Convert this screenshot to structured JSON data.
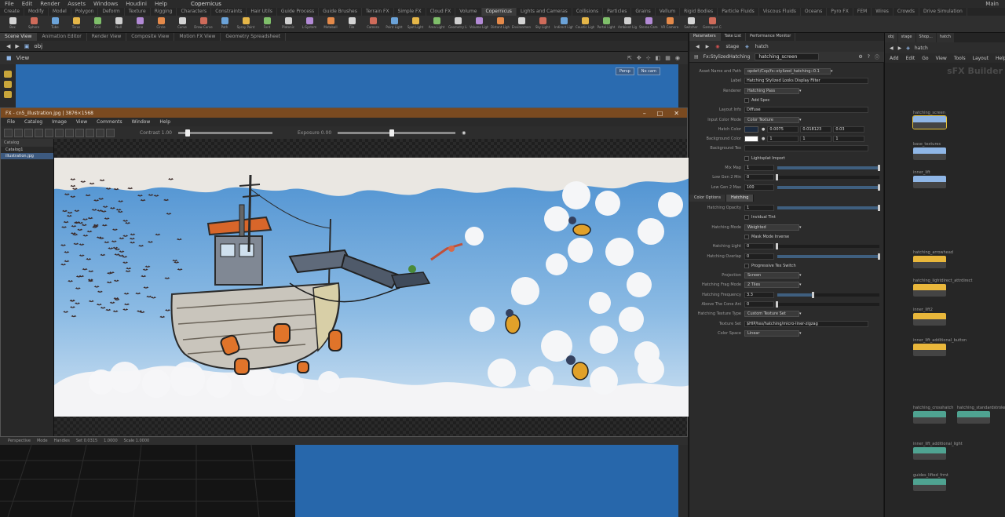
{
  "menubar": {
    "items": [
      "File",
      "Edit",
      "Render",
      "Assets",
      "Windows",
      "Houdini",
      "Help"
    ],
    "desktop": "Copernicus",
    "right_label": "Main"
  },
  "shelf_tabs": [
    "Create",
    "Modify",
    "Model",
    "Polygon",
    "Deform",
    "Texture",
    "Rigging",
    "Characters",
    "Constraints",
    "Hair Utils",
    "Guide Process",
    "Guide Brushes",
    "Terrain FX",
    "Simple FX",
    "Cloud FX",
    "Volume",
    "Copernicus",
    "Lights and Cameras",
    "Collisions",
    "Particles",
    "Grains",
    "Vellum",
    "Rigid Bodies",
    "Particle Fluids",
    "Viscous Fluids",
    "Oceans",
    "Pyro FX",
    "FEM",
    "Wires",
    "Crowds",
    "Drive Simulation"
  ],
  "shelf_tools": [
    "Box",
    "Sphere",
    "Tube",
    "Torus",
    "Grid",
    "Null",
    "Line",
    "Circle",
    "Curve",
    "Draw Curve",
    "Path",
    "Spray Paint",
    "Font",
    "Platonic",
    "L-System",
    "Metaball",
    "File",
    "Camera",
    "Point Light",
    "Spot Light",
    "Area Light",
    "Geometry Light",
    "Volume Light",
    "Distant Light",
    "Environment Light",
    "Sky Light",
    "Indirect Light",
    "Caustic Light",
    "Portal Light",
    "Ambient Light",
    "Stereo Camera",
    "VR Camera",
    "Switcher",
    "Gamepad Camera"
  ],
  "pane_tabs": [
    "Scene View",
    "Animation Editor",
    "Render View",
    "Composite View",
    "Motion FX View",
    "Geometry Spreadsheet"
  ],
  "path": "obj",
  "view_label": "View",
  "viewport": {
    "btn1": "Persp",
    "btn2": "No cam"
  },
  "image_window": {
    "title": "FX - cn5_illustration.jpg | 3876×1568",
    "menu": [
      "File",
      "Catalog",
      "Image",
      "View",
      "Comments",
      "Window",
      "Help"
    ],
    "contrast_label": "Contrast",
    "contrast_value": "1.00",
    "exposure_label": "Exposure",
    "exposure_value": "0.00",
    "contrast_level": 0.1,
    "exposure_level": 0.46,
    "side_header": "Catalog",
    "side_items": [
      "Catalog1",
      "illustration.jpg"
    ]
  },
  "bottom_status": [
    "Perspective",
    "Mode",
    "Handles",
    "Set 0.0315",
    "1.0000",
    "Scale 1.0000"
  ],
  "params": {
    "tabs": [
      "Parameters",
      "Take List",
      "Performance Monitor"
    ],
    "path": [
      "stage",
      "hatch"
    ],
    "node_type": "Fx:StylizedHatching",
    "node_name": "hatching_screen",
    "rows": [
      {
        "label": "Asset Name and Path",
        "value": "opdef:/Cop/fx::stylized_hatching::0.1",
        "kind": "dd"
      },
      {
        "label": "Label",
        "value": "Hatching Stylized Looks Display Filter",
        "kind": "field"
      },
      {
        "label": "Renderer",
        "value": "Hatching Pass",
        "kind": "dd"
      },
      {
        "label": "",
        "value": "Add Spec",
        "kind": "check"
      },
      {
        "label": "Layout Info",
        "value": "Diffuse",
        "kind": "field"
      },
      {
        "label": "Input Color Mode",
        "value": "Color Texture",
        "kind": "dd"
      },
      {
        "label": "Hatch Color",
        "value": "",
        "kind": "color3",
        "v1": "0.0075",
        "v2": "0.018123",
        "v3": "0.03"
      },
      {
        "label": "Background Color",
        "value": "",
        "kind": "color3",
        "v1": "1",
        "v2": "1",
        "v3": "1"
      },
      {
        "label": "Background Tex",
        "value": "",
        "kind": "field"
      },
      {
        "label": "",
        "value": "Lightsplat Import",
        "kind": "check"
      },
      {
        "label": "Mix Map",
        "value": "1",
        "kind": "slider",
        "level": 1.0
      },
      {
        "label": "Low Gen 2 Min",
        "value": "0",
        "kind": "slider",
        "level": 0.0
      },
      {
        "label": "Low Gen 2 Max",
        "value": "100",
        "kind": "slider",
        "level": 1.0
      }
    ],
    "section_tabs": [
      "Color Options",
      "Hatching"
    ],
    "rows2": [
      {
        "label": "Hatching Opacity",
        "value": "1",
        "kind": "slider",
        "level": 1.0
      },
      {
        "label": "",
        "value": "Invidual Tint",
        "kind": "check"
      },
      {
        "label": "Hatching Mode",
        "value": "Weighted",
        "kind": "dd"
      },
      {
        "label": "",
        "value": "Mask Mode Inverse",
        "kind": "check"
      },
      {
        "label": "Hatching Light",
        "value": "0",
        "kind": "slider",
        "level": 0.0
      },
      {
        "label": "Hatching Overlap",
        "value": "0",
        "kind": "slider",
        "level": 1.0
      },
      {
        "label": "",
        "value": "Progressive Tex Switch",
        "kind": "check"
      },
      {
        "label": "Projection",
        "value": "Screen",
        "kind": "dd"
      },
      {
        "label": "Hatching Frag Mode",
        "value": "2 Tiles",
        "kind": "dd"
      },
      {
        "label": "Hatching Frequency",
        "value": "3.3",
        "kind": "slider",
        "level": 0.35
      },
      {
        "label": "Above The Cone Ani",
        "value": "0",
        "kind": "slider",
        "level": 0.0
      },
      {
        "label": "Hatching Texture Type",
        "value": "Custom Texture Set",
        "kind": "dd"
      },
      {
        "label": "Texture Set",
        "value": "$HIP/tex/hatching/micro-liner-zigzag",
        "kind": "field"
      },
      {
        "label": "Color Space",
        "value": "Linear",
        "kind": "dd"
      }
    ]
  },
  "network": {
    "tabs": [
      "obj",
      "stage",
      "Shop...",
      "hatch"
    ],
    "path": "hatch",
    "menu": [
      "Add",
      "Edit",
      "Go",
      "View",
      "Tools",
      "Layout",
      "Help"
    ],
    "title": "sFX Builder",
    "nodes": [
      {
        "label": "hatching_screen",
        "color": "#8fb6e6",
        "sel": true
      },
      {
        "label": "base_textures",
        "color": "#8fb6e6",
        "sel": false
      },
      {
        "label": "inner_lift",
        "color": "#8fb6e6",
        "sel": false
      },
      {
        "label": "hatching_arrowhead",
        "color": "#e9b73b",
        "sel": false
      },
      {
        "label": "hatching_lightdirect_attrdirect",
        "color": "#e9b73b",
        "sel": false
      },
      {
        "label": "inner_lift2",
        "color": "#e9b73b",
        "sel": false
      },
      {
        "label": "inner_lift_additional_button",
        "color": "#e9b73b",
        "sel": false
      },
      {
        "label": "hatching_crosshatch",
        "color": "#4fa391",
        "sel": false
      },
      {
        "label": "hatching_standardstroke",
        "color": "#4fa391",
        "sel": false
      },
      {
        "label": "inner_lift_additional_light",
        "color": "#4fa391",
        "sel": false
      },
      {
        "label": "guides_lifted_frmt",
        "color": "#4fa391",
        "sel": false
      }
    ]
  }
}
